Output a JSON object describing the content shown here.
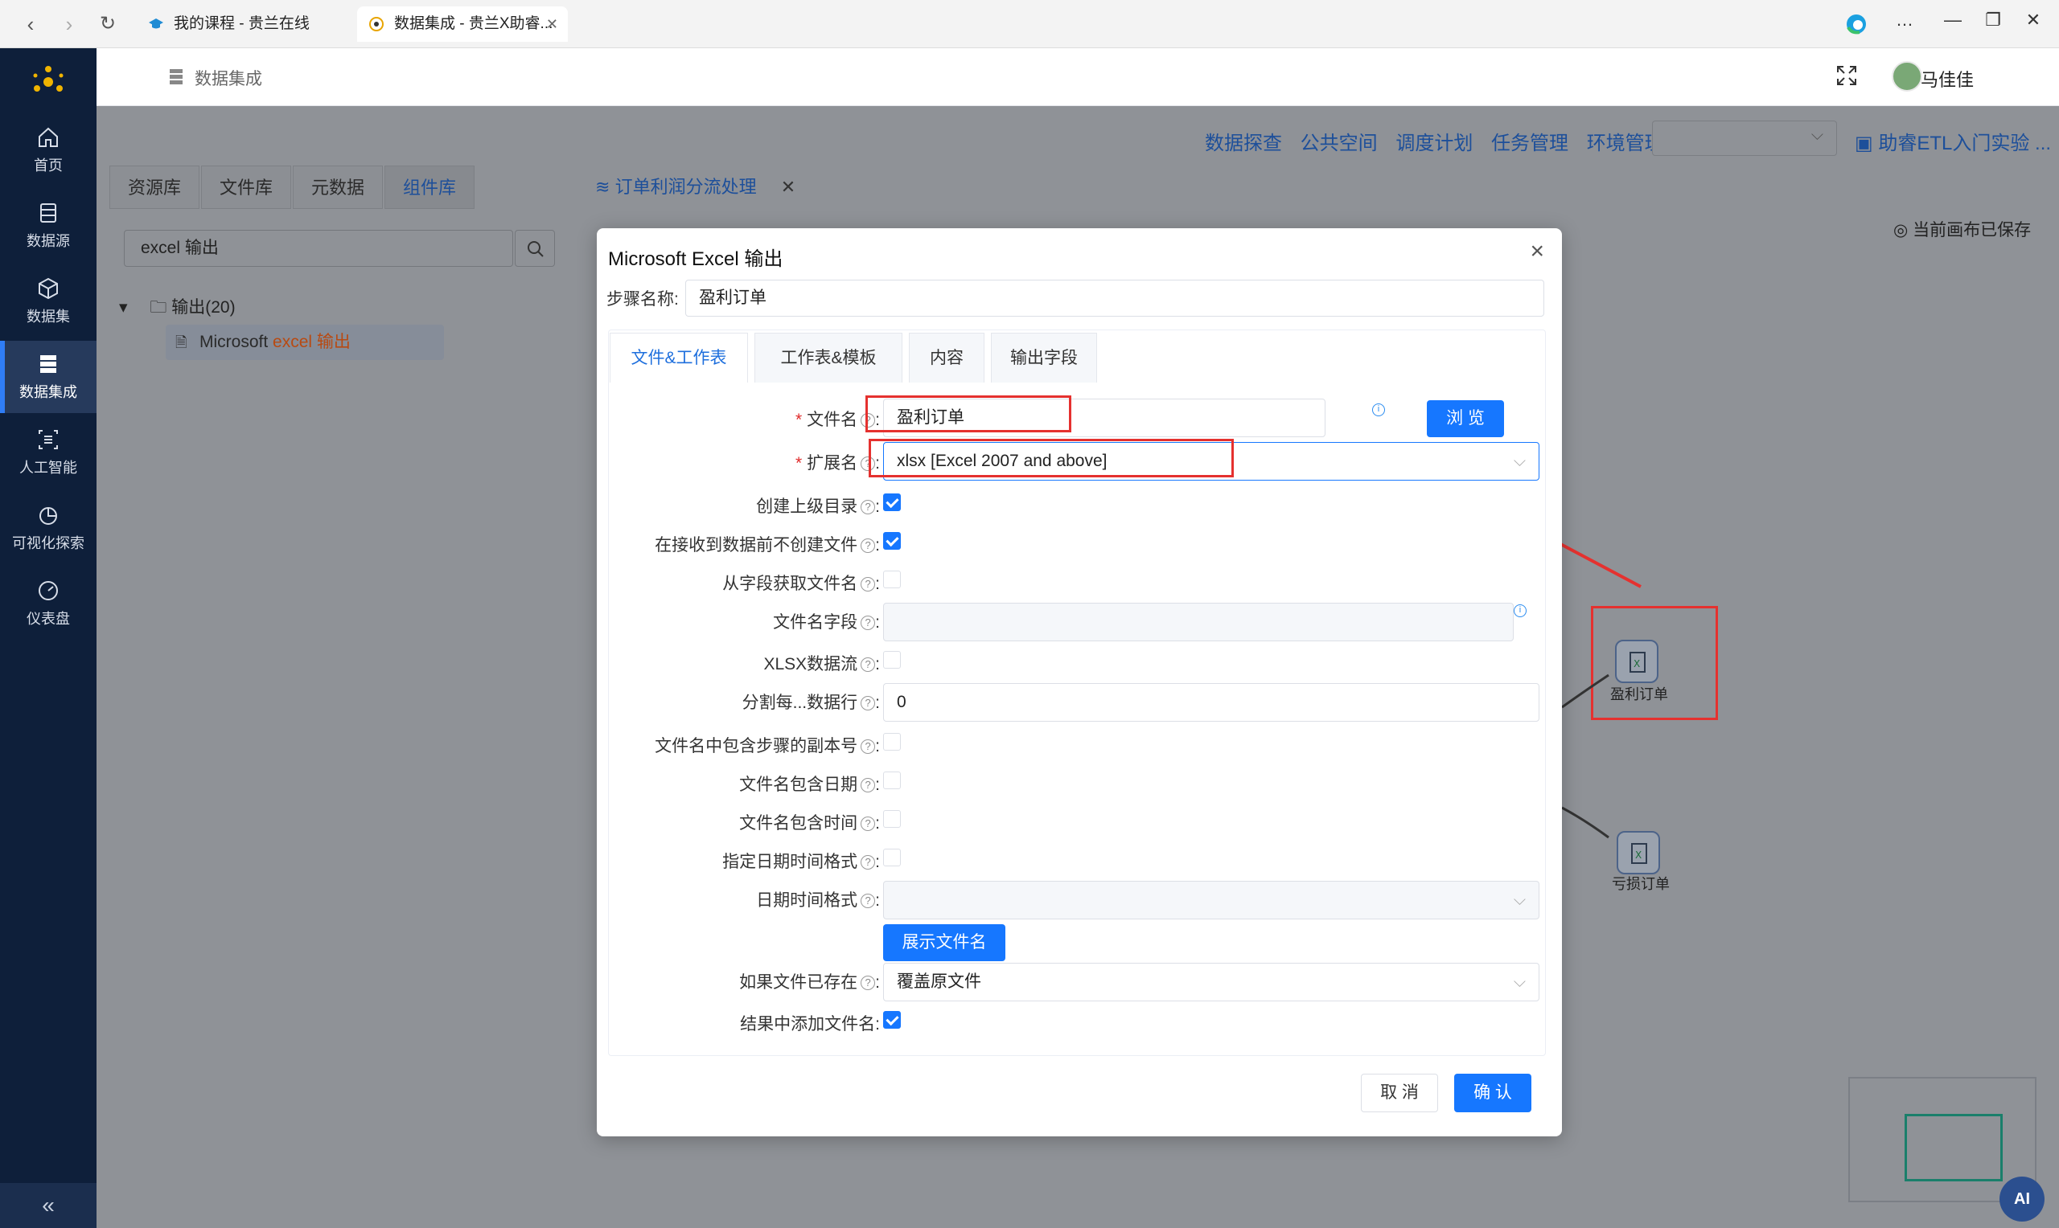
{
  "browser": {
    "tabs": [
      {
        "label": "我的课程 - 贵兰在线"
      },
      {
        "label": "数据集成 - 贵兰X助睿..."
      }
    ],
    "win_controls": [
      "…",
      "—",
      "❐",
      "✕"
    ]
  },
  "sidebar": {
    "items": [
      {
        "label": "首页",
        "icon": "home-icon"
      },
      {
        "label": "数据源",
        "icon": "database-icon"
      },
      {
        "label": "数据集",
        "icon": "cube-icon"
      },
      {
        "label": "数据集成",
        "icon": "server-icon"
      },
      {
        "label": "人工智能",
        "icon": "ai-icon"
      },
      {
        "label": "可视化探索",
        "icon": "pie-chart-icon"
      },
      {
        "label": "仪表盘",
        "icon": "gauge-icon"
      }
    ],
    "collapse_label": "«"
  },
  "header": {
    "breadcrumb": "数据集成",
    "user_name": "马佳佳"
  },
  "toolbar": {
    "links": [
      "数据探查",
      "公共空间",
      "调度计划",
      "任务管理",
      "环境管理"
    ],
    "project_link": "助睿ETL入门实验 ..."
  },
  "library": {
    "tabs": [
      "资源库",
      "文件库",
      "元数据",
      "组件库"
    ],
    "search_value": "excel 输出",
    "folder": "输出(20)",
    "node_prefix": "Microsoft ",
    "node_hl": "excel 输出"
  },
  "canvas": {
    "tab_label": "订单利润分流处理",
    "saved_text": "当前画布已保存",
    "nodes": [
      {
        "label": "盈利订单"
      },
      {
        "label": "亏损订单"
      }
    ],
    "ai_badge": "AI"
  },
  "dialog": {
    "title": "Microsoft Excel 输出",
    "step_label": "步骤名称:",
    "step_value": "盈利订单",
    "tabs": [
      "文件&工作表",
      "工作表&模板",
      "内容",
      "输出字段"
    ],
    "fields": {
      "filename_label": "文件名",
      "filename_value": "盈利订单",
      "browse": "浏 览",
      "ext_label": "扩展名",
      "ext_value": "xlsx [Excel 2007 and above]",
      "create_parent_label": "创建上级目录",
      "no_create_label": "在接收到数据前不创建文件",
      "from_field_label": "从字段获取文件名",
      "filename_field_label": "文件名字段",
      "xlsx_stream_label": "XLSX数据流",
      "split_label": "分割每...数据行",
      "split_value": "0",
      "include_copy_label": "文件名中包含步骤的副本号",
      "include_date_label": "文件名包含日期",
      "include_time_label": "文件名包含时间",
      "specify_fmt_label": "指定日期时间格式",
      "datetime_fmt_label": "日期时间格式",
      "show_filename": "展示文件名",
      "if_exists_label": "如果文件已存在",
      "if_exists_value": "覆盖原文件",
      "add_to_result_label": "结果中添加文件名"
    },
    "cancel": "取 消",
    "confirm": "确 认"
  },
  "colors": {
    "primary": "#1677ff",
    "sidebar": "#0e1f3a",
    "annotation": "#e5312f"
  }
}
